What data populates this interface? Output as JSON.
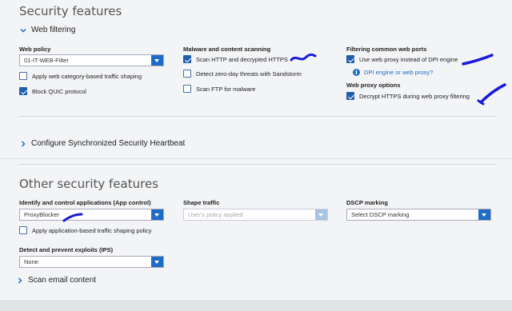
{
  "section1": {
    "title": "Security features",
    "web_filtering_label": "Web filtering",
    "web_policy": {
      "heading": "Web policy",
      "value": "01-IT-WEB-Filter"
    },
    "apply_category_shaping": {
      "label": "Apply web category-based traffic shaping",
      "checked": false
    },
    "block_quic": {
      "label": "Block QUIC protocol",
      "checked": true
    },
    "malware": {
      "heading": "Malware and content scanning",
      "scan_http": {
        "label": "Scan HTTP and decrypted HTTPS",
        "checked": true
      },
      "zero_day": {
        "label": "Detect zero-day threats with Sandstorm",
        "checked": false
      },
      "scan_ftp": {
        "label": "Scan FTP for malware",
        "checked": false
      }
    },
    "ports": {
      "heading": "Filtering common web ports",
      "use_proxy": {
        "label": "Use web proxy instead of DPI engine",
        "checked": true
      },
      "info_link": "DPI engine or web proxy?"
    },
    "proxy_options": {
      "heading": "Web proxy options",
      "decrypt_https": {
        "label": "Decrypt HTTPS during web proxy filtering",
        "checked": true
      }
    },
    "heartbeat_label": "Configure Synchronized Security Heartbeat"
  },
  "section2": {
    "title": "Other security features",
    "app_control": {
      "heading": "Identify and control applications (App control)",
      "value": "ProxyBlocker"
    },
    "shape_traffic": {
      "heading": "Shape traffic",
      "value": "User's policy applied"
    },
    "dscp": {
      "heading": "DSCP marking",
      "value": "Select DSCP marking"
    },
    "apply_app_shaping": {
      "label": "Apply application-based traffic shaping policy",
      "checked": false
    },
    "ips": {
      "heading": "Detect and prevent exploits (IPS)",
      "value": "None"
    },
    "scan_email_label": "Scan email content"
  },
  "colors": {
    "accent": "#1f6cc6",
    "annotation_ink": "#1a1adb"
  }
}
